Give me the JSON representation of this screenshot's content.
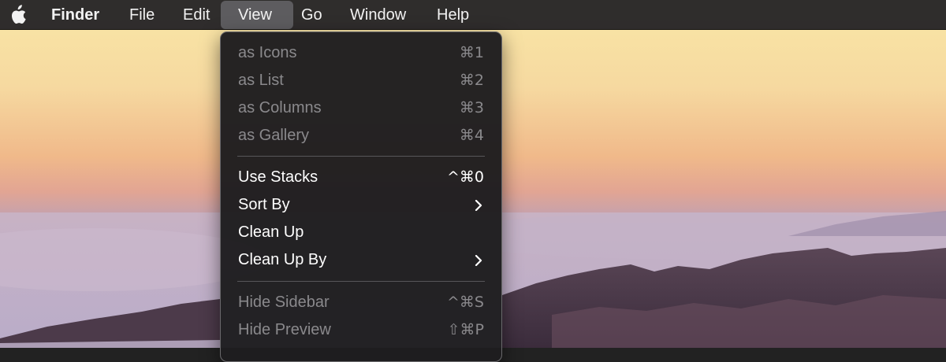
{
  "menubar": {
    "apple_icon": "apple-logo-icon",
    "items": [
      {
        "label": "Finder"
      },
      {
        "label": "File"
      },
      {
        "label": "Edit"
      },
      {
        "label": "View"
      },
      {
        "label": "Go"
      },
      {
        "label": "Window"
      },
      {
        "label": "Help"
      }
    ],
    "active_item": "View"
  },
  "view_menu": {
    "groups": [
      {
        "items": [
          {
            "label": "as Icons",
            "shortcut": "⌘1",
            "enabled": false
          },
          {
            "label": "as List",
            "shortcut": "⌘2",
            "enabled": false
          },
          {
            "label": "as Columns",
            "shortcut": "⌘3",
            "enabled": false
          },
          {
            "label": "as Gallery",
            "shortcut": "⌘4",
            "enabled": false
          }
        ]
      },
      {
        "items": [
          {
            "label": "Use Stacks",
            "shortcut": "^⌘0",
            "enabled": true
          },
          {
            "label": "Sort By",
            "submenu_icon": "chevron-right-icon",
            "enabled": true
          },
          {
            "label": "Clean Up",
            "enabled": true
          },
          {
            "label": "Clean Up By",
            "submenu_icon": "chevron-right-icon",
            "enabled": true
          }
        ]
      },
      {
        "items": [
          {
            "label": "Hide Sidebar",
            "shortcut": "^⌘S",
            "enabled": false
          },
          {
            "label": "Hide Preview",
            "shortcut": "⇧⌘P",
            "enabled": false
          }
        ]
      }
    ]
  },
  "colors": {
    "menubar_bg": "#282628",
    "menu_bg": "#1e1d1f",
    "active_highlight": "#5d5c5f",
    "text_enabled": "#ffffff",
    "text_disabled": "#8a898c"
  }
}
